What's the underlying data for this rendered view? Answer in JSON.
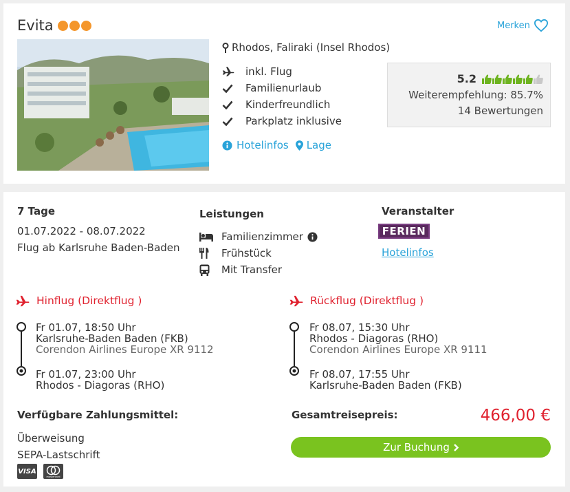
{
  "hotel": {
    "name": "Evita",
    "category_dots": 3,
    "merken_label": "Merken",
    "location": "Rhodos, Faliraki (Insel Rhodos)",
    "features": [
      {
        "icon": "plane-icon",
        "label": "inkl. Flug"
      },
      {
        "icon": "check-icon",
        "label": "Familienurlaub"
      },
      {
        "icon": "check-icon",
        "label": "Kinderfreundlich"
      },
      {
        "icon": "check-icon",
        "label": "Parkplatz inklusive"
      }
    ],
    "links": {
      "info": "Hotelinfos",
      "location": "Lage"
    },
    "rating": {
      "score": "5.2",
      "thumbs_filled": 5,
      "thumbs_total": 6,
      "recommendation": "Weiterempfehlung: 85.7%",
      "reviews": "14 Bewertungen"
    }
  },
  "offer": {
    "duration": "7 Tage",
    "dates": "01.07.2022 - 08.07.2022",
    "departure": "Flug ab Karlsruhe Baden-Baden",
    "services_title": "Leistungen",
    "services": [
      {
        "icon": "bed-icon",
        "label": "Familienzimmer"
      },
      {
        "icon": "cutlery-icon",
        "label": "Frühstück"
      },
      {
        "icon": "bus-icon",
        "label": "Mit Transfer"
      }
    ],
    "operator_title": "Veranstalter",
    "operator_logo_text": "FERIEN",
    "operator_link": "Hotelinfos"
  },
  "flights": {
    "outbound": {
      "title": "Hinflug (Direktflug )",
      "dep_time": "Fr 01.07, 18:50 Uhr",
      "dep_airport": "Karlsruhe-Baden Baden (FKB)",
      "airline": "Corendon Airlines Europe XR 9112",
      "arr_time": "Fr 01.07, 23:00 Uhr",
      "arr_airport": "Rhodos - Diagoras (RHO)"
    },
    "return": {
      "title": "Rückflug (Direktflug )",
      "dep_time": "Fr 08.07, 15:30 Uhr",
      "dep_airport": "Rhodos - Diagoras (RHO)",
      "airline": "Corendon Airlines Europe XR 9111",
      "arr_time": "Fr 08.07, 17:55 Uhr",
      "arr_airport": "Karlsruhe-Baden Baden (FKB)"
    }
  },
  "payment": {
    "title": "Verfügbare Zahlungsmittel:",
    "methods": [
      "Überweisung",
      "SEPA-Lastschrift"
    ],
    "cards": [
      "VISA",
      "mastercard"
    ]
  },
  "price": {
    "label": "Gesamtreisepreis:",
    "value": "466,00 €",
    "button": "Zur Buchung"
  },
  "colors": {
    "accent_blue": "#29a3d9",
    "price_red": "#e0222f",
    "button_green": "#7ac31f",
    "dot_orange": "#f4962b",
    "thumb_green": "#6db31f"
  }
}
